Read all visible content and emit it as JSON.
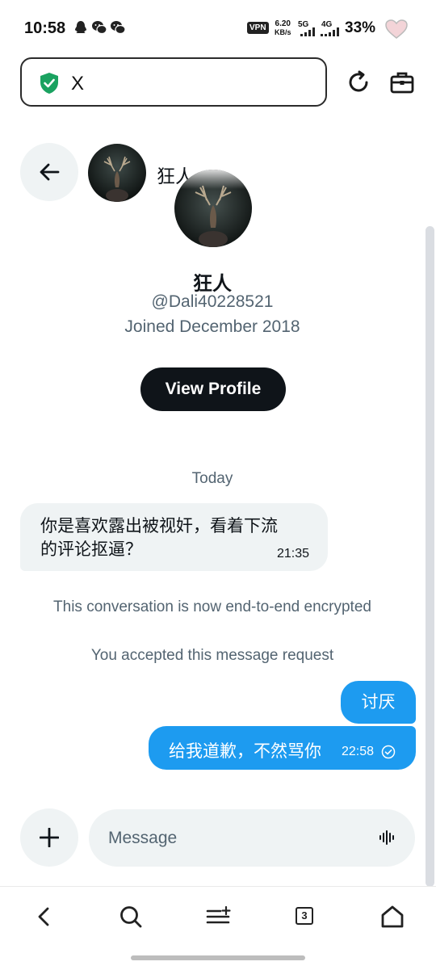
{
  "status_bar": {
    "time": "10:58",
    "vpn": "VPN",
    "net_speed": "6.20",
    "net_speed_unit": "KB/s",
    "sig1_label": "5G",
    "sig2_label": "4G",
    "battery": "33%"
  },
  "browser": {
    "address_text": "X"
  },
  "header": {
    "name": "狂人"
  },
  "profile": {
    "name": "狂人",
    "handle": "@Dali40228521",
    "joined": "Joined December 2018",
    "view_profile_label": "View Profile"
  },
  "messages": {
    "date_label": "Today",
    "incoming": {
      "line1": "你是喜欢露出被视奸，看着下流",
      "line2": "的评论抠逼？",
      "time": "21:35"
    },
    "system_1": "This conversation is now end-to-end encrypted",
    "system_2": "You accepted this message request",
    "outgoing": [
      {
        "text": "讨厌"
      },
      {
        "text": "给我道歉，不然骂你",
        "time": "22:58"
      }
    ]
  },
  "composer": {
    "placeholder": "Message"
  },
  "bottom_nav": {
    "tab_count": "3"
  },
  "colors": {
    "accent": "#1d9bf0",
    "bubble_gray": "#eff3f4",
    "text_secondary": "#536471",
    "button_dark": "#0f1419",
    "shield_green": "#1aa260"
  }
}
